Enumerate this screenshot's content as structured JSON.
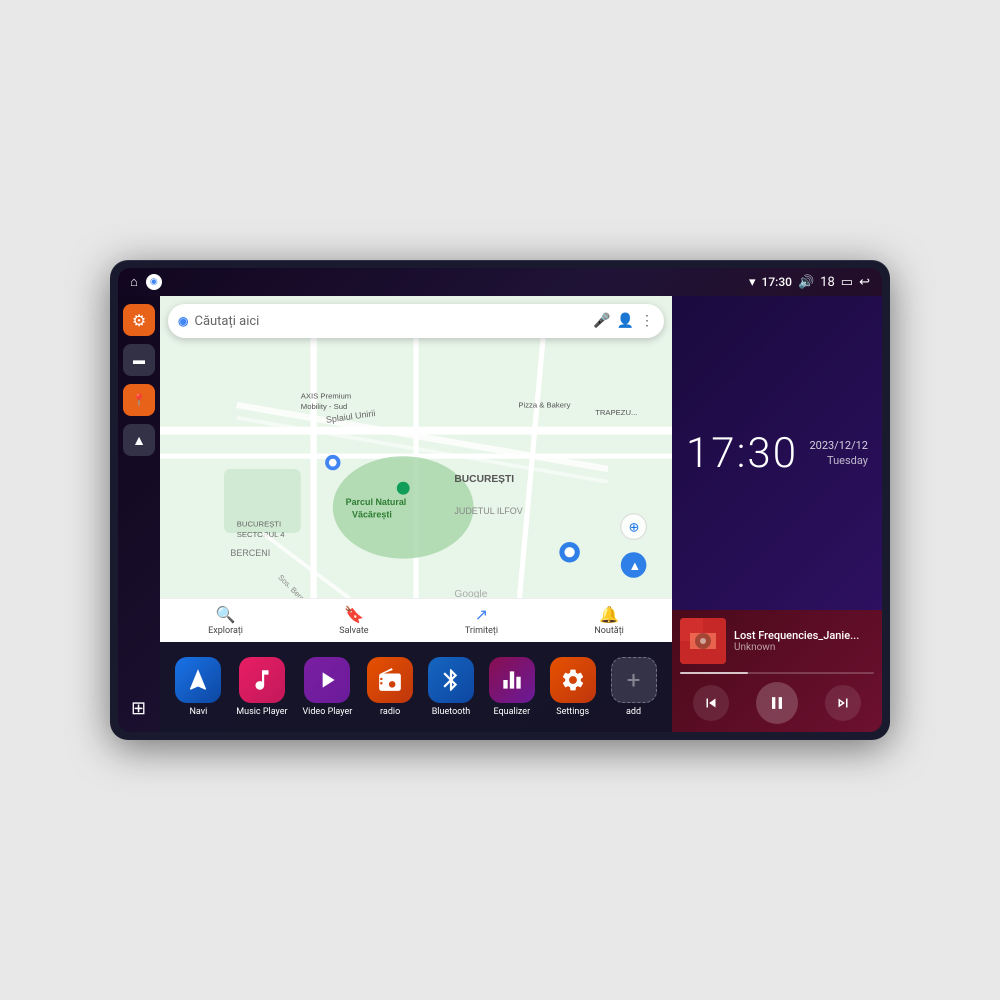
{
  "device": {
    "statusBar": {
      "leftIcons": [
        "home-icon",
        "maps-icon"
      ],
      "time": "17:30",
      "rightIcons": [
        "wifi-icon",
        "volume-icon",
        "battery-icon",
        "back-icon"
      ],
      "batteryLevel": "18"
    },
    "sidebar": {
      "items": [
        {
          "id": "settings",
          "icon": "⚙",
          "label": "Settings",
          "color": "orange"
        },
        {
          "id": "files",
          "icon": "▭",
          "label": "Files",
          "color": "dark"
        },
        {
          "id": "maps",
          "icon": "◉",
          "label": "Maps",
          "color": "orange"
        },
        {
          "id": "navigation",
          "icon": "▷",
          "label": "Navigation",
          "color": "dark"
        },
        {
          "id": "apps",
          "icon": "⊞",
          "label": "Apps Grid",
          "color": "grid"
        }
      ]
    },
    "map": {
      "searchPlaceholder": "Căutați aici",
      "bottomItems": [
        {
          "icon": "◉",
          "label": "Explorați"
        },
        {
          "icon": "⊕",
          "label": "Salvate"
        },
        {
          "icon": "↗",
          "label": "Trimiteți"
        },
        {
          "icon": "🔔",
          "label": "Noutăți"
        }
      ],
      "locations": [
        "Parcul Natural Văcărești",
        "BUCUREȘTI",
        "JUDETUL ILFOV",
        "BUCUREȘTI SECTORUL 4",
        "BERCENI",
        "AXIS Premium Mobility - Sud",
        "Pizza & Bakery",
        "TRAPEZU..."
      ],
      "googleLabel": "Google"
    },
    "clock": {
      "time": "17:30",
      "date": "2023/12/12",
      "day": "Tuesday"
    },
    "musicPlayer": {
      "trackTitle": "Lost Frequencies_Janie...",
      "artist": "Unknown",
      "progressPercent": 35
    },
    "apps": [
      {
        "id": "navi",
        "label": "Navi",
        "icon": "▷",
        "colorClass": "icon-navi"
      },
      {
        "id": "music-player",
        "label": "Music Player",
        "icon": "♪",
        "colorClass": "icon-music"
      },
      {
        "id": "video-player",
        "label": "Video Player",
        "icon": "▶",
        "colorClass": "icon-video"
      },
      {
        "id": "radio",
        "label": "radio",
        "icon": "📶",
        "colorClass": "icon-radio"
      },
      {
        "id": "bluetooth",
        "label": "Bluetooth",
        "icon": "⚡",
        "colorClass": "icon-bluetooth"
      },
      {
        "id": "equalizer",
        "label": "Equalizer",
        "icon": "≡",
        "colorClass": "icon-equalizer"
      },
      {
        "id": "settings",
        "label": "Settings",
        "icon": "⚙",
        "colorClass": "icon-settings"
      },
      {
        "id": "add",
        "label": "add",
        "icon": "+",
        "colorClass": "icon-add"
      }
    ]
  }
}
